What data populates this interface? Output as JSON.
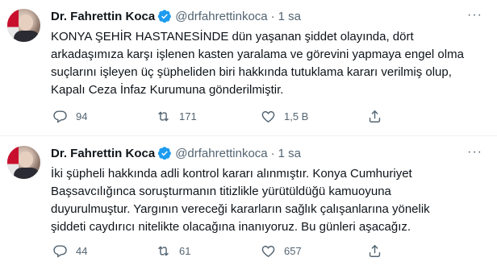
{
  "tweets": [
    {
      "author_name": "Dr. Fahrettin Koca",
      "handle": "@drfahrettinkoca",
      "separator": "·",
      "time": "1 sa",
      "more": "···",
      "text_lines": [
        "KONYA ŞEHİR HASTANESİNDE dün yaşanan şiddet olayında, dört",
        "arkadaşımıza karşı işlenen kasten yaralama ve görevini yapmaya engel olma",
        "suçlarını işleyen üç şüpheliden biri hakkında tutuklama kararı verilmiş olup,",
        "Kapalı Ceza İnfaz Kurumuna gönderilmiştir."
      ],
      "replies": "94",
      "retweets": "171",
      "likes": "1,5 B"
    },
    {
      "author_name": "Dr. Fahrettin Koca",
      "handle": "@drfahrettinkoca",
      "separator": "·",
      "time": "1 sa",
      "more": "···",
      "text_lines": [
        "İki şüpheli hakkında adli kontrol kararı alınmıştır. Konya Cumhuriyet",
        "Başsavcılığınca soruşturmanın titizlikle yürütüldüğü kamuoyuna",
        "duyurulmuştur. Yargının vereceği kararların sağlık çalışanlarına yönelik",
        "şiddeti caydırıcı nitelikte olacağına inanıyoruz. Bu günleri aşacağız."
      ],
      "replies": "44",
      "retweets": "61",
      "likes": "657"
    }
  ],
  "colors": {
    "text": "#0f1419",
    "secondary": "#536471",
    "verified": "#1d9bf0",
    "divider": "#eff3f4"
  },
  "icons": [
    "reply-icon",
    "retweet-icon",
    "like-icon",
    "share-icon",
    "verified-icon",
    "more-icon"
  ]
}
